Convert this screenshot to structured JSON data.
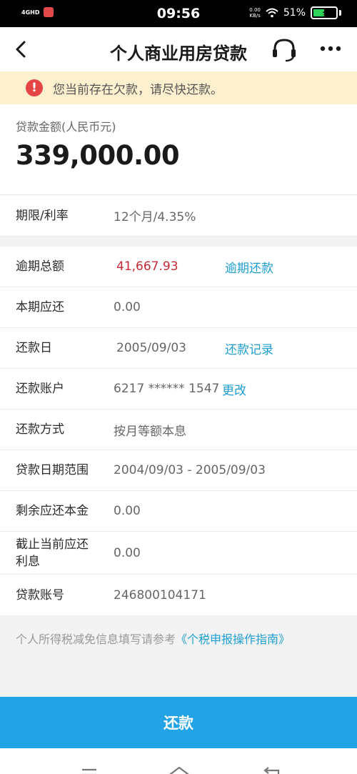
{
  "status_bar": {
    "network": "4GHD",
    "time": "09:56",
    "speed_value": "0.00",
    "speed_unit": "KB/s",
    "battery_pct": "51%",
    "battery_level": 0.51
  },
  "nav": {
    "title": "个人商业用房贷款"
  },
  "notice": {
    "icon_text": "!",
    "text": "您当前存在欠款，请尽快还款。"
  },
  "loan": {
    "amount_label": "贷款金额(人民币元)",
    "amount_value": "339,000.00"
  },
  "term_row": {
    "label": "期限/利率",
    "value": "12个月/4.35%"
  },
  "details": {
    "overdue_label": "逾期总额",
    "overdue_value": "41,667.93",
    "overdue_link": "逾期还款",
    "due_label": "本期应还",
    "due_value": "0.00",
    "repay_day_label": "还款日",
    "repay_day_value": "2005/09/03",
    "repay_record_link": "还款记录",
    "account_label": "还款账户",
    "account_value": "6217 ****** 1547",
    "account_change_link": "更改",
    "method_label": "还款方式",
    "method_value": "按月等额本息",
    "range_label": "贷款日期范围",
    "range_value": "2004/09/03 - 2005/09/03",
    "principal_label": "剩余应还本金",
    "principal_value": "0.00",
    "interest_label_line1": "截止当前应还",
    "interest_label_line2": "利息",
    "interest_value": "0.00",
    "loan_no_label": "贷款账号",
    "loan_no_value": "246800104171"
  },
  "footer": {
    "tax_note": "个人所得税减免信息填写请参考",
    "tax_link": "《个税申报操作指南》"
  },
  "button": {
    "repay_label": "还款"
  },
  "icons": {
    "back": "chevron-left-icon",
    "service": "headset-icon",
    "more": "more-dots-icon",
    "alert": "alert-icon",
    "menu": "menu-icon",
    "home": "home-icon",
    "back_nav": "return-icon"
  },
  "colors": {
    "accent": "#21a3e6",
    "link": "#1e9ed2",
    "overdue": "#c62a35",
    "notice_bg": "#fdf0ce",
    "alert": "#e64545"
  }
}
